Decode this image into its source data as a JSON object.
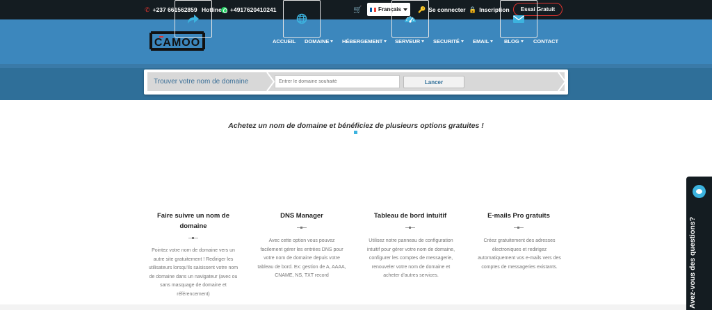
{
  "topbar": {
    "phone": "+237 661562859",
    "hotline_label": "Hotline",
    "whatsapp": "+4917620410241",
    "language": "Français",
    "login": "Se connecter",
    "signup": "Inscription",
    "trial": "Essai Gratuit"
  },
  "header": {
    "logo_text": "CAMOO",
    "nav": [
      {
        "label": "ACCUEIL"
      },
      {
        "label": "DOMAINE"
      },
      {
        "label": "HÉBERGEMENT"
      },
      {
        "label": "SERVEUR"
      },
      {
        "label": "SECURITÉ"
      },
      {
        "label": "EMAIL"
      },
      {
        "label": "BLOG"
      },
      {
        "label": "CONTACT"
      }
    ]
  },
  "search": {
    "label": "Trouver votre nom de domaine",
    "placeholder": "Entrer le domaine souhaité",
    "button": "Lancer"
  },
  "main": {
    "headline": "Achetez un nom de domaine et bénéficiez de plusieurs options gratuites !",
    "features": [
      {
        "icon": "share-arrow-icon",
        "title": "Faire suivre un nom de domaine",
        "desc": "Pointez votre nom de domaine vers un autre site gratuitement ! Rediriger les utilisateurs lorsqu'ils saisissent votre nom de domaine dans un navigateur (avec ou sans masquage de domaine et référencement)"
      },
      {
        "icon": "globe-icon",
        "title": "DNS Manager",
        "desc": "Avec cette option vous pouvez facilement gérer les entrées DNS pour votre nom de domaine depuis votre tableau de bord. Ex: gestion de A, AAAA, CNAME, NS, TXT record"
      },
      {
        "icon": "dashboard-gauge-icon",
        "title": "Tableau de bord intuitif",
        "desc": "Utilisez notre panneau de configuration intuitif pour gérer votre nom de domaine, configurer les comptes de messagerie, renouveler votre nom de domaine et acheter d'autres services."
      },
      {
        "icon": "envelope-icon",
        "title": "E-mails Pro gratuits",
        "desc": "Créez gratuitement des adresses électroniques et redirigez automatiquement vos e-mails vers des comptes de messageries existants."
      }
    ]
  },
  "chat": {
    "label": "Avez-vous des questions?"
  },
  "colors": {
    "topbar": "#141c21",
    "header": "#3c87bd",
    "band": "#2f6f99",
    "accent": "#3cb3df",
    "trial_border": "#e3342f"
  }
}
